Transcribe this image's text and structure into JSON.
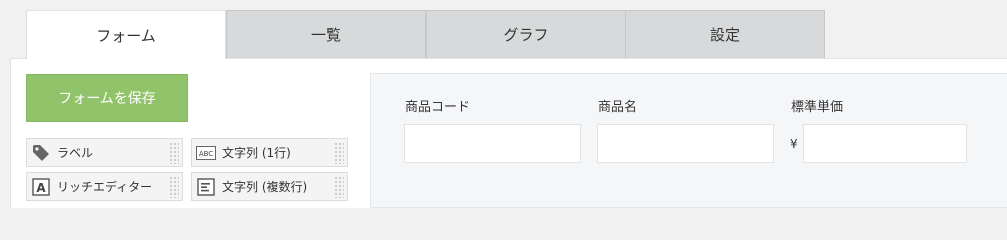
{
  "tabs": [
    {
      "label": "フォーム",
      "active": true
    },
    {
      "label": "一覧",
      "active": false
    },
    {
      "label": "グラフ",
      "active": false
    },
    {
      "label": "設定",
      "active": false
    }
  ],
  "toolbar": {
    "save_label": "フォームを保存",
    "save_color": "#91c46a"
  },
  "palette": {
    "items": [
      {
        "label": "ラベル",
        "icon": "tag-icon"
      },
      {
        "label": "文字列 (1行)",
        "icon": "abc-text-icon",
        "icon_text": "ABC"
      },
      {
        "label": "リッチエディター",
        "icon": "rich-editor-icon",
        "icon_text": "A"
      },
      {
        "label": "文字列 (複数行)",
        "icon": "multiline-text-icon"
      }
    ]
  },
  "form": {
    "fields": [
      {
        "label": "商品コード",
        "value": ""
      },
      {
        "label": "商品名",
        "value": ""
      },
      {
        "label": "標準単価",
        "prefix": "¥",
        "value": ""
      }
    ]
  }
}
